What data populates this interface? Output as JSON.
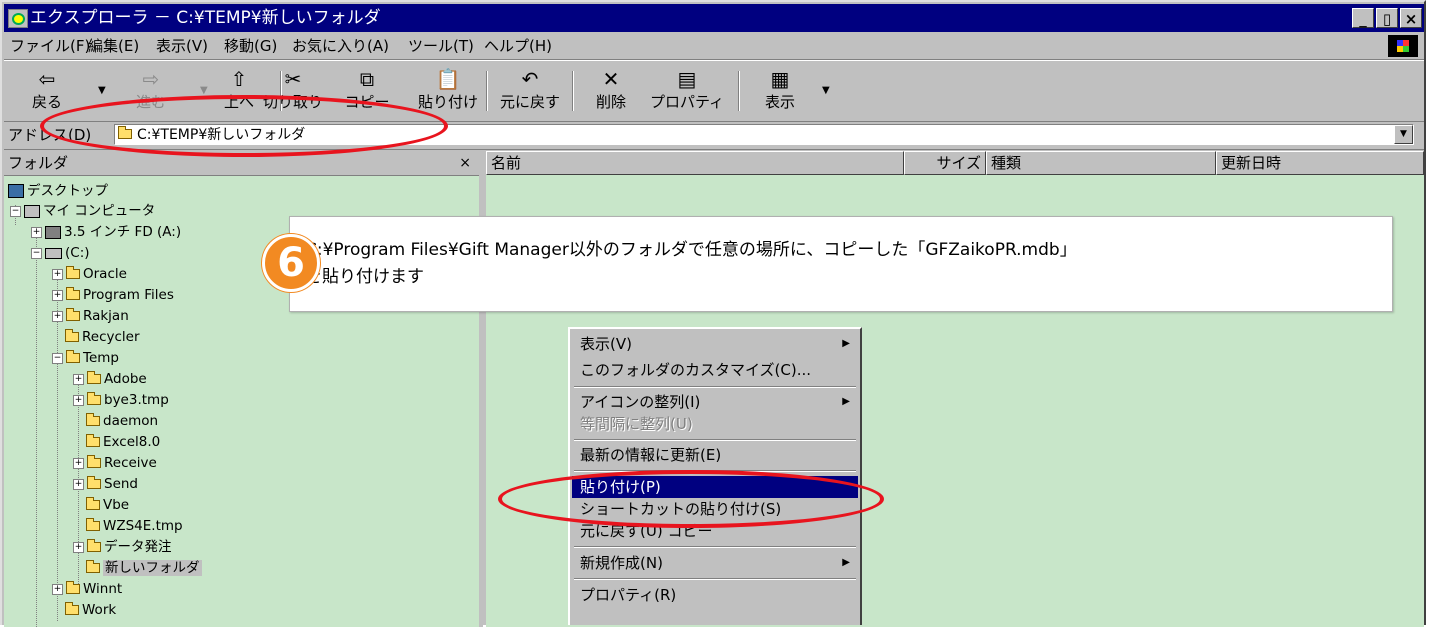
{
  "window": {
    "title": "エクスプローラ － C:¥TEMP¥新しいフォルダ",
    "min_label": "_",
    "max_label": "▯",
    "close_label": "×"
  },
  "menubar": {
    "items": [
      "ファイル(F)",
      "編集(E)",
      "表示(V)",
      "移動(G)",
      "お気に入り(A)",
      "ツール(T)",
      "ヘルプ(H)"
    ]
  },
  "toolbar": {
    "back": "戻る",
    "forward": "進む",
    "up": "上へ",
    "cut": "切り取り",
    "copy": "コピー",
    "paste": "貼り付け",
    "undo": "元に戻す",
    "delete": "削除",
    "properties": "プロパティ",
    "view": "表示"
  },
  "address": {
    "label": "アドレス(D)",
    "value": "C:¥TEMP¥新しいフォルダ"
  },
  "folder_pane": {
    "title": "フォルダ",
    "close": "×",
    "tree": {
      "desktop": "デスクトップ",
      "mycomputer": "マイ コンピュータ",
      "fd": "3.5 インチ FD (A:)",
      "c": "(C:)",
      "oracle": "Oracle",
      "program_files": "Program Files",
      "rakjan": "Rakjan",
      "recycler": "Recycler",
      "temp": "Temp",
      "adobe": "Adobe",
      "bye3": "bye3.tmp",
      "daemon": "daemon",
      "excel": "Excel8.0",
      "receive": "Receive",
      "send": "Send",
      "vbe": "Vbe",
      "wzs": "WZS4E.tmp",
      "data": "データ発注",
      "newfolder": "新しいフォルダ",
      "winnt": "Winnt",
      "work": "Work"
    }
  },
  "file_pane": {
    "columns": [
      "名前",
      "サイズ",
      "種類",
      "更新日時"
    ]
  },
  "context_menu": {
    "view": "表示(V)",
    "customize": "このフォルダのカスタマイズ(C)...",
    "arrange": "アイコンの整列(I)",
    "lineup": "等間隔に整列(U)",
    "refresh": "最新の情報に更新(E)",
    "paste": "貼り付け(P)",
    "paste_shortcut": "ショートカットの貼り付け(S)",
    "undo_copy": "元に戻す(U) コピー",
    "new": "新規作成(N)",
    "properties": "プロパティ(R)"
  },
  "callout": {
    "step": "6",
    "line1": "C:¥Program Files¥Gift Manager以外のフォルダで任意の場所に、コピーした「GFZaikoPR.mdb」",
    "line2": "を貼り付けます"
  },
  "colors": {
    "title_bar": "#000080",
    "pane_bg": "#c8e6c9",
    "highlight_ring": "#e8141e",
    "badge": "#f28a22"
  }
}
